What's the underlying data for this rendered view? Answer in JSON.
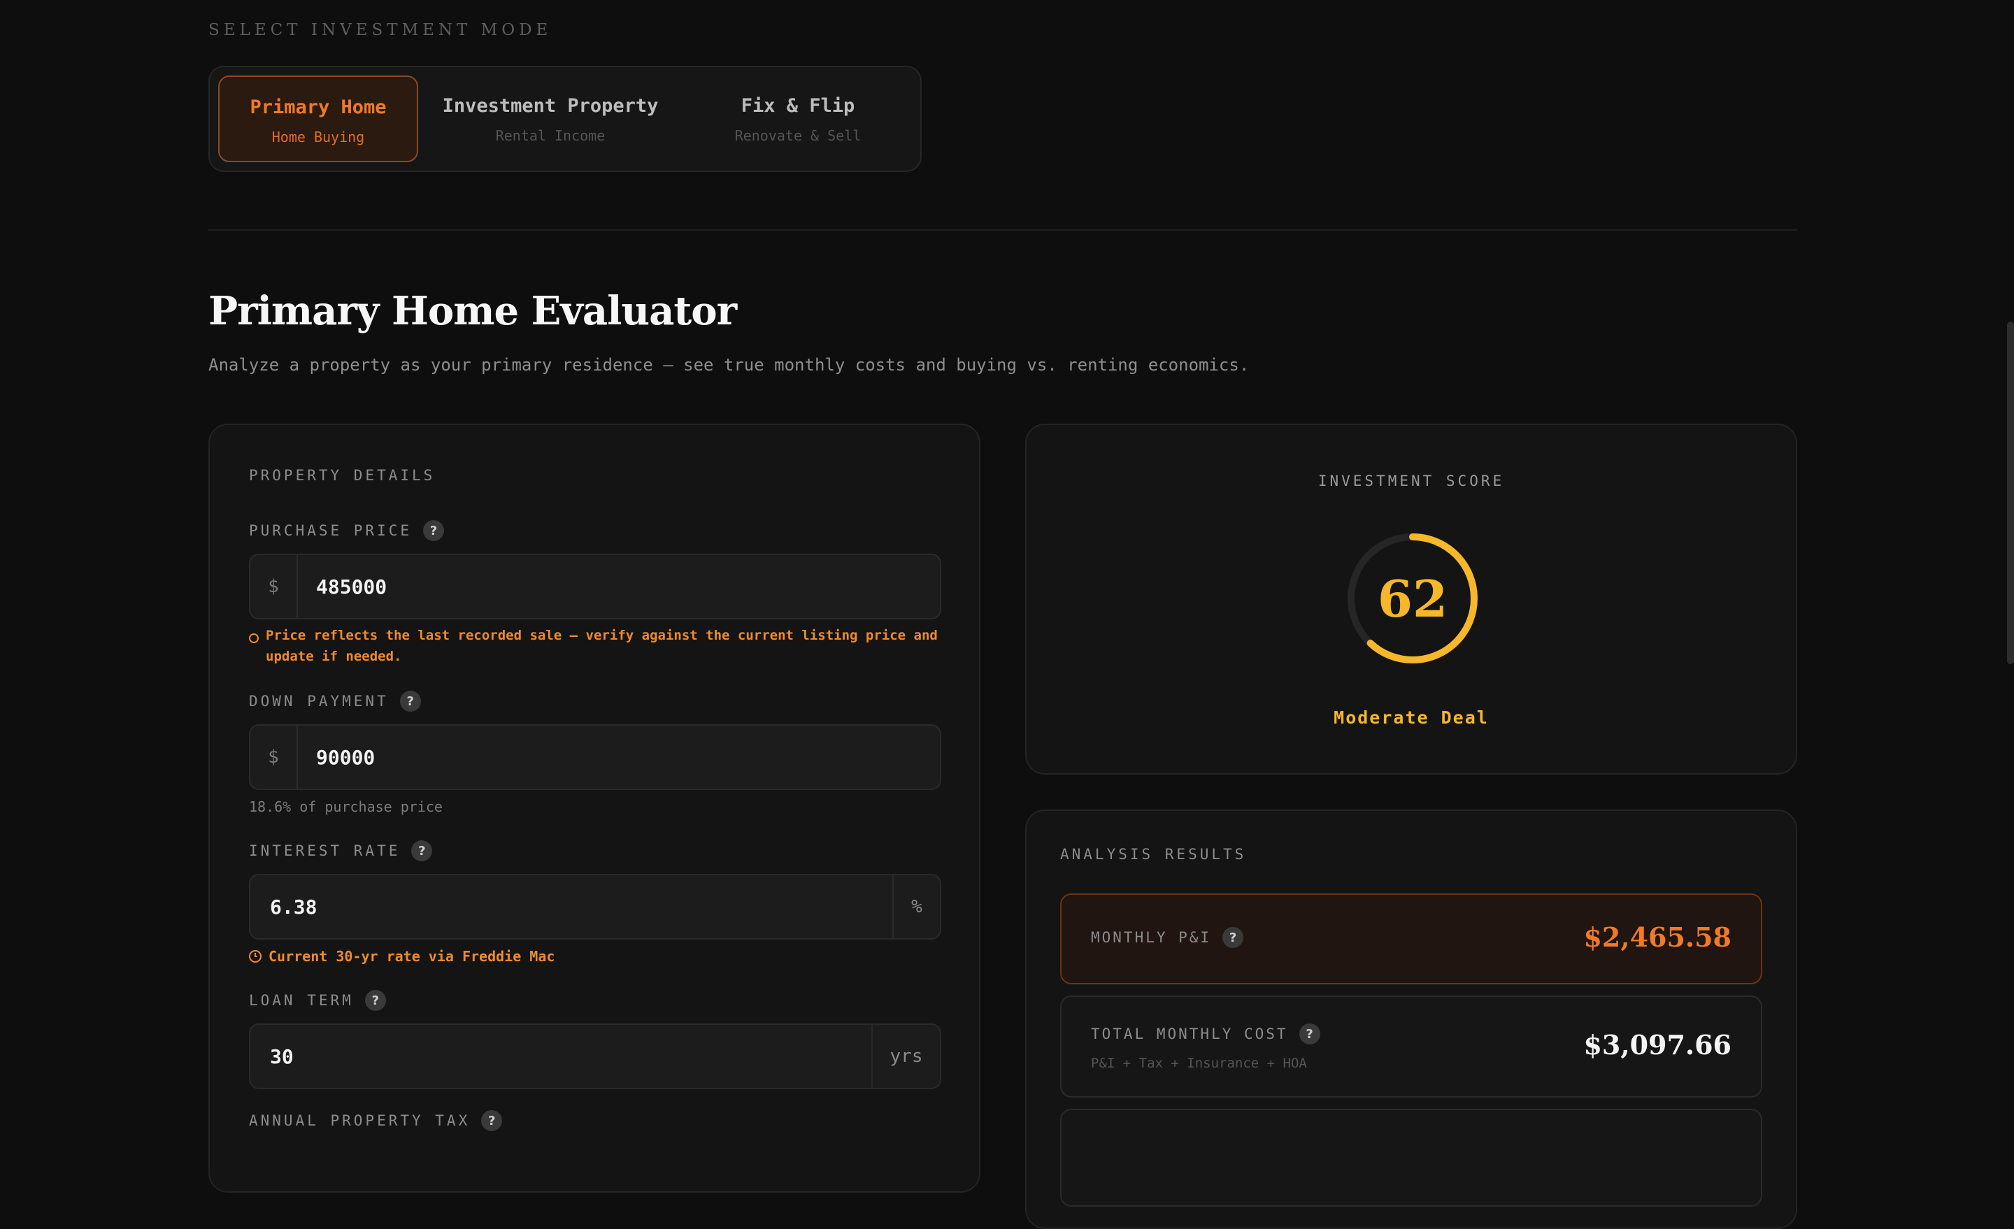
{
  "mode_selector": {
    "label": "SELECT INVESTMENT MODE",
    "options": [
      {
        "title": "Primary Home",
        "subtitle": "Home Buying",
        "active": true
      },
      {
        "title": "Investment Property",
        "subtitle": "Rental Income",
        "active": false
      },
      {
        "title": "Fix & Flip",
        "subtitle": "Renovate & Sell",
        "active": false
      }
    ]
  },
  "page": {
    "title": "Primary Home Evaluator",
    "subtitle": "Analyze a property as your primary residence — see true monthly costs and buying vs. renting economics."
  },
  "property_details": {
    "section_label": "PROPERTY DETAILS",
    "purchase_price": {
      "label": "PURCHASE PRICE",
      "prefix": "$",
      "value": "485000",
      "warning": "Price reflects the last recorded sale — verify against the current listing price and update if needed."
    },
    "down_payment": {
      "label": "DOWN PAYMENT",
      "prefix": "$",
      "value": "90000",
      "hint": "18.6% of purchase price"
    },
    "interest_rate": {
      "label": "INTEREST RATE",
      "value": "6.38",
      "suffix": "%",
      "note": "Current 30-yr rate via Freddie Mac"
    },
    "loan_term": {
      "label": "LOAN TERM",
      "value": "30",
      "suffix": "yrs"
    },
    "annual_property_tax": {
      "label": "ANNUAL PROPERTY TAX"
    },
    "help_glyph": "?"
  },
  "score": {
    "label": "INVESTMENT SCORE",
    "value": 62,
    "max": 100,
    "verdict": "Moderate Deal",
    "color": "#f6b72a"
  },
  "results": {
    "section_label": "ANALYSIS RESULTS",
    "monthly_pi": {
      "label": "MONTHLY P&I",
      "value": "$2,465.58"
    },
    "total_monthly_cost": {
      "label": "TOTAL MONTHLY COST",
      "sub": "P&I + Tax + Insurance + HOA",
      "value": "$3,097.66"
    }
  },
  "colors": {
    "accent": "#f07a2a",
    "score": "#f6b72a",
    "background": "#0e0e0e"
  }
}
